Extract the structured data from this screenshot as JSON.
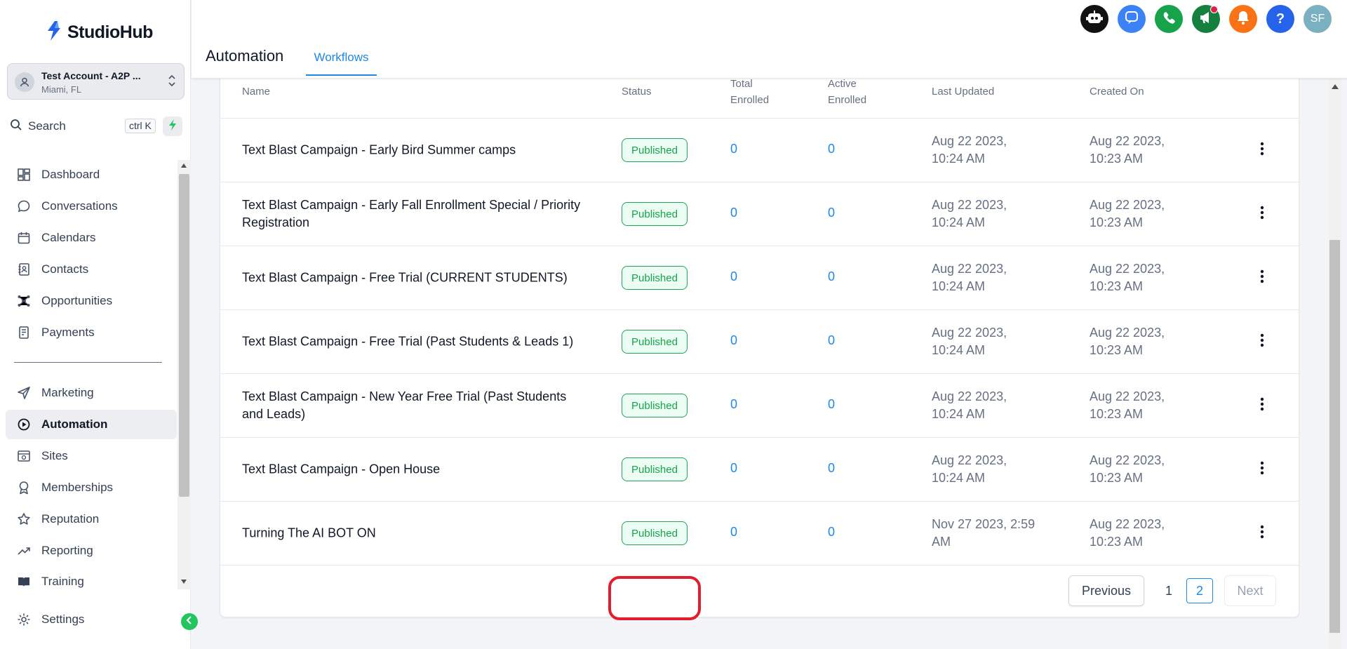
{
  "brand": {
    "name": "StudioHub"
  },
  "account": {
    "name": "Test Account - A2P ...",
    "location": "Miami, FL"
  },
  "search": {
    "label": "Search",
    "shortcut": "ctrl K"
  },
  "sidebar": {
    "items": [
      {
        "label": "Dashboard",
        "icon": "dashboard-icon"
      },
      {
        "label": "Conversations",
        "icon": "chat-icon"
      },
      {
        "label": "Calendars",
        "icon": "calendar-icon"
      },
      {
        "label": "Contacts",
        "icon": "contacts-icon"
      },
      {
        "label": "Opportunities",
        "icon": "opportunities-icon"
      },
      {
        "label": "Payments",
        "icon": "payments-icon"
      },
      {
        "label": "Marketing",
        "icon": "send-icon"
      },
      {
        "label": "Automation",
        "icon": "automation-icon"
      },
      {
        "label": "Sites",
        "icon": "sites-icon"
      },
      {
        "label": "Memberships",
        "icon": "membership-icon"
      },
      {
        "label": "Reputation",
        "icon": "star-icon"
      },
      {
        "label": "Reporting",
        "icon": "trend-icon"
      },
      {
        "label": "Training",
        "icon": "book-icon"
      }
    ],
    "settings_label": "Settings",
    "active": "Automation"
  },
  "header": {
    "title": "Automation",
    "tab": "Workflows",
    "avatar_initials": "SF",
    "help": "?"
  },
  "table": {
    "columns": {
      "name": "Name",
      "status": "Status",
      "total_l1": "Total",
      "total_l2": "Enrolled",
      "active_l1": "Active",
      "active_l2": "Enrolled",
      "updated": "Last Updated",
      "created": "Created On"
    },
    "rows": [
      {
        "name": "Text Blast Campaign - Early Bird Summer camps",
        "status": "Published",
        "total": "0",
        "active": "0",
        "updated_l1": "Aug 22 2023,",
        "updated_l2": "10:24 AM",
        "created_l1": "Aug 22 2023,",
        "created_l2": "10:23 AM"
      },
      {
        "name": "Text Blast Campaign - Early Fall Enrollment Special / Priority Registration",
        "status": "Published",
        "total": "0",
        "active": "0",
        "updated_l1": "Aug 22 2023,",
        "updated_l2": "10:24 AM",
        "created_l1": "Aug 22 2023,",
        "created_l2": "10:23 AM"
      },
      {
        "name": "Text Blast Campaign - Free Trial (CURRENT STUDENTS)",
        "status": "Published",
        "total": "0",
        "active": "0",
        "updated_l1": "Aug 22 2023,",
        "updated_l2": "10:24 AM",
        "created_l1": "Aug 22 2023,",
        "created_l2": "10:23 AM"
      },
      {
        "name": "Text Blast Campaign - Free Trial (Past Students & Leads 1)",
        "status": "Published",
        "total": "0",
        "active": "0",
        "updated_l1": "Aug 22 2023,",
        "updated_l2": "10:24 AM",
        "created_l1": "Aug 22 2023,",
        "created_l2": "10:23 AM"
      },
      {
        "name": "Text Blast Campaign - New Year Free Trial (Past Students and Leads)",
        "status": "Published",
        "total": "0",
        "active": "0",
        "updated_l1": "Aug 22 2023,",
        "updated_l2": "10:24 AM",
        "created_l1": "Aug 22 2023,",
        "created_l2": "10:23 AM"
      },
      {
        "name": "Text Blast Campaign - Open House",
        "status": "Published",
        "total": "0",
        "active": "0",
        "updated_l1": "Aug 22 2023,",
        "updated_l2": "10:24 AM",
        "created_l1": "Aug 22 2023,",
        "created_l2": "10:23 AM"
      },
      {
        "name": "Turning The AI BOT ON",
        "status": "Published",
        "total": "0",
        "active": "0",
        "updated_l1": "Nov 27 2023, 2:59",
        "updated_l2": "AM",
        "created_l1": "Aug 22 2023,",
        "created_l2": "10:23 AM"
      }
    ]
  },
  "pagination": {
    "previous": "Previous",
    "pages": [
      "1",
      "2"
    ],
    "current": "2",
    "next": "Next"
  },
  "colors": {
    "accent": "#1e88e5",
    "published": "#16a34a",
    "highlight": "#e11d2e"
  }
}
